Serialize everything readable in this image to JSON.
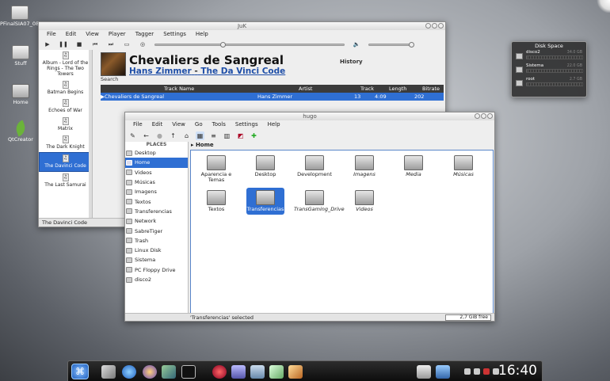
{
  "desktop": {
    "icons": [
      {
        "label": "PFinalSIA07_08_A8098..."
      },
      {
        "label": "Stuff"
      },
      {
        "label": "Home"
      },
      {
        "label": "QtCreator"
      }
    ]
  },
  "juk": {
    "title": "JuK",
    "menu": [
      "File",
      "Edit",
      "View",
      "Player",
      "Tagger",
      "Settings",
      "Help"
    ],
    "playlists": [
      "Album - Lord of the Rings - The Two Towers",
      "Batman Begins",
      "Echoes of War",
      "Matrix",
      "The Dark Knight",
      "The Davinci Code",
      "The Last Samurai"
    ],
    "selected_playlist": "The Davinci Code",
    "now_playing": {
      "title": "Chevaliers de Sangreal",
      "artist": "Hans Zimmer",
      "separator": "-",
      "album": "The Da Vinci Code"
    },
    "history_label": "History",
    "search_label": "Search",
    "columns": [
      "Track Name",
      "Artist",
      "Track",
      "Length",
      "Bitrate"
    ],
    "row": {
      "name": "Chevaliers de Sangreal",
      "artist": "Hans Zimmer",
      "track": "13",
      "length": "4:09",
      "bitrate": "202"
    },
    "status": "The Davinci Code"
  },
  "dolphin": {
    "title": "hugo",
    "menu": [
      "File",
      "Edit",
      "View",
      "Go",
      "Tools",
      "Settings",
      "Help"
    ],
    "places_title": "PLACES",
    "places": [
      "Desktop",
      "Home",
      "Videos",
      "Músicas",
      "Imagens",
      "Textos",
      "Transferencias",
      "Network",
      "SabreTiger",
      "Trash",
      "Linux Disk",
      "Sistema",
      "PC Floppy Drive",
      "disco2"
    ],
    "selected_place": "Home",
    "breadcrumb": "Home",
    "files": [
      {
        "name": "Aparencia e Temas"
      },
      {
        "name": "Desktop"
      },
      {
        "name": "Development"
      },
      {
        "name": "Imagens"
      },
      {
        "name": "Media"
      },
      {
        "name": "Músicas"
      },
      {
        "name": "Textos"
      },
      {
        "name": "Transferencias"
      },
      {
        "name": "TransGaming_Drive"
      },
      {
        "name": "Videos"
      }
    ],
    "status": "'Transferencias' selected",
    "free": "2,7 GiB free"
  },
  "disk_widget": {
    "title": "Disk Space",
    "disks": [
      {
        "name": "disco2",
        "pct": "34.0 GB"
      },
      {
        "name": "Sistema",
        "pct": "22.0 GB"
      },
      {
        "name": "root",
        "pct": "2.7 GB"
      }
    ]
  },
  "taskbar": {
    "clock": "16:40"
  }
}
